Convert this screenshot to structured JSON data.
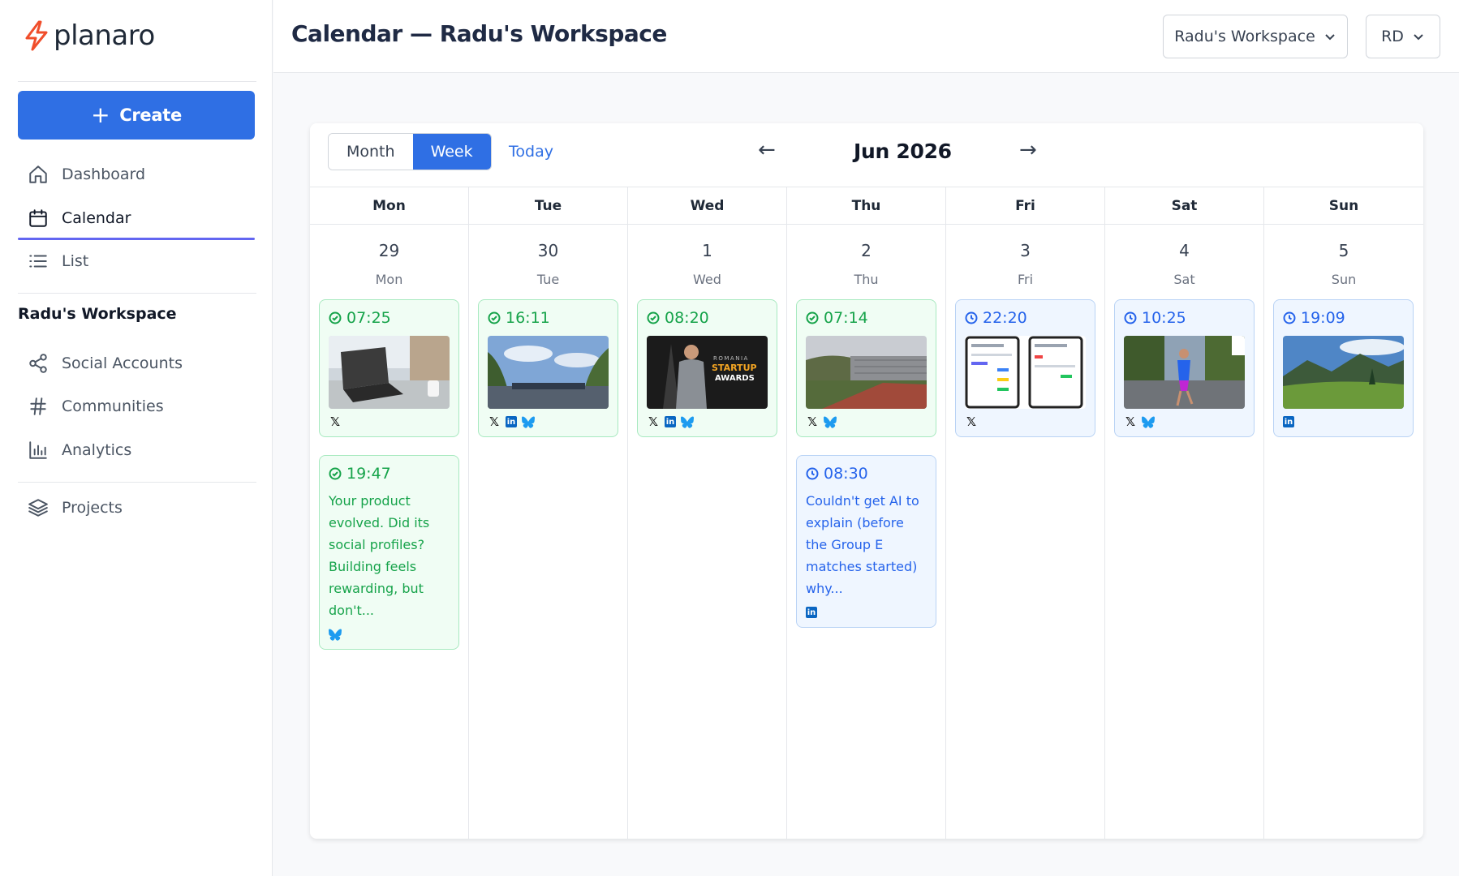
{
  "brand": {
    "name": "planaro",
    "accent": "#f04e2b"
  },
  "sidebar": {
    "create_label": "Create",
    "nav": [
      {
        "label": "Dashboard",
        "icon": "home-icon"
      },
      {
        "label": "Calendar",
        "icon": "calendar-icon",
        "active": true
      },
      {
        "label": "List",
        "icon": "list-icon"
      }
    ],
    "workspace_heading": "Radu's Workspace",
    "workspace_nav": [
      {
        "label": "Social Accounts",
        "icon": "share-icon"
      },
      {
        "label": "Communities",
        "icon": "hash-icon"
      },
      {
        "label": "Analytics",
        "icon": "bar-chart-icon"
      }
    ],
    "projects_label": "Projects"
  },
  "header": {
    "title": "Calendar — Radu's Workspace",
    "workspace_select": "Radu's Workspace",
    "user_select": "RD"
  },
  "calendar": {
    "view_month": "Month",
    "view_week": "Week",
    "today": "Today",
    "prev": "←",
    "next": "→",
    "period": "Jun 2026",
    "days": [
      {
        "head": "Mon",
        "num": "29",
        "name": "Mon"
      },
      {
        "head": "Tue",
        "num": "30",
        "name": "Tue"
      },
      {
        "head": "Wed",
        "num": "1",
        "name": "Wed"
      },
      {
        "head": "Thu",
        "num": "2",
        "name": "Thu"
      },
      {
        "head": "Fri",
        "num": "3",
        "name": "Fri"
      },
      {
        "head": "Sat",
        "num": "4",
        "name": "Sat"
      },
      {
        "head": "Sun",
        "num": "5",
        "name": "Sun"
      }
    ],
    "posts": {
      "mon1": {
        "time": "07:25",
        "status": "published",
        "networks": [
          "x"
        ]
      },
      "mon2": {
        "time": "19:47",
        "status": "published",
        "text": "Your product evolved. Did its social profiles? Building feels rewarding, but don't...",
        "networks": [
          "bluesky"
        ]
      },
      "tue1": {
        "time": "16:11",
        "status": "published",
        "networks": [
          "x",
          "linkedin",
          "bluesky"
        ]
      },
      "wed1": {
        "time": "08:20",
        "status": "published",
        "image_text": [
          "ROMANIA",
          "STARTUP",
          "AWARDS"
        ],
        "networks": [
          "x",
          "linkedin",
          "bluesky"
        ]
      },
      "thu1": {
        "time": "07:14",
        "status": "published",
        "networks": [
          "x",
          "bluesky"
        ]
      },
      "thu2": {
        "time": "08:30",
        "status": "scheduled",
        "text": "Couldn't get AI to explain (before the Group E matches started) why...",
        "networks": [
          "linkedin"
        ]
      },
      "fri1": {
        "time": "22:20",
        "status": "scheduled",
        "networks": [
          "x"
        ]
      },
      "sat1": {
        "time": "10:25",
        "status": "scheduled",
        "networks": [
          "x",
          "bluesky"
        ]
      },
      "sun1": {
        "time": "19:09",
        "status": "scheduled",
        "networks": [
          "linkedin"
        ]
      }
    },
    "colors": {
      "published": "#16a34a",
      "scheduled": "#2563eb",
      "primary": "#2f6fe4"
    }
  }
}
